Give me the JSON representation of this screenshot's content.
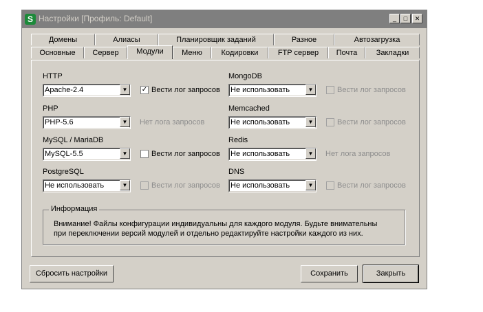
{
  "window": {
    "title": "Настройки [Профиль: Default]",
    "icon_letter": "S",
    "minimize_glyph": "_",
    "maximize_glyph": "□",
    "close_glyph": "✕"
  },
  "tabs": {
    "row1": [
      "Домены",
      "Алиасы",
      "Планировщик заданий",
      "Разное",
      "Автозагрузка"
    ],
    "row2": [
      "Основные",
      "Сервер",
      "Модули",
      "Меню",
      "Кодировки",
      "FTP сервер",
      "Почта",
      "Закладки"
    ],
    "active": "Модули"
  },
  "modules": {
    "http": {
      "label": "HTTP",
      "value": "Apache-2.4",
      "log_label": "Вести лог запросов",
      "log_checked": true
    },
    "php": {
      "label": "PHP",
      "value": "PHP-5.6",
      "no_log_text": "Нет лога запросов"
    },
    "mysql": {
      "label": "MySQL / MariaDB",
      "value": "MySQL-5.5",
      "log_label": "Вести лог запросов",
      "log_checked": false
    },
    "postgresql": {
      "label": "PostgreSQL",
      "value": "Не использовать",
      "log_label": "Вести лог запросов",
      "log_checked": false
    },
    "mongodb": {
      "label": "MongoDB",
      "value": "Не использовать",
      "log_label": "Вести лог запросов",
      "log_checked": false
    },
    "memcached": {
      "label": "Memcached",
      "value": "Не использовать",
      "log_label": "Вести лог запросов",
      "log_checked": false
    },
    "redis": {
      "label": "Redis",
      "value": "Не использовать",
      "no_log_text": "Нет лога запросов"
    },
    "dns": {
      "label": "DNS",
      "value": "Не использовать",
      "log_label": "Вести лог запросов",
      "log_checked": false
    }
  },
  "info": {
    "title": "Информация",
    "line1": "Внимание! Файлы конфигурации индивидуальны для каждого модуля. Будьте внимательны",
    "line2": "при переключении версий модулей и отдельно редактируйте настройки каждого из них."
  },
  "buttons": {
    "reset": "Сбросить настройки",
    "save": "Сохранить",
    "close": "Закрыть"
  },
  "glyphs": {
    "dropdown": "▼",
    "check": "✓"
  }
}
